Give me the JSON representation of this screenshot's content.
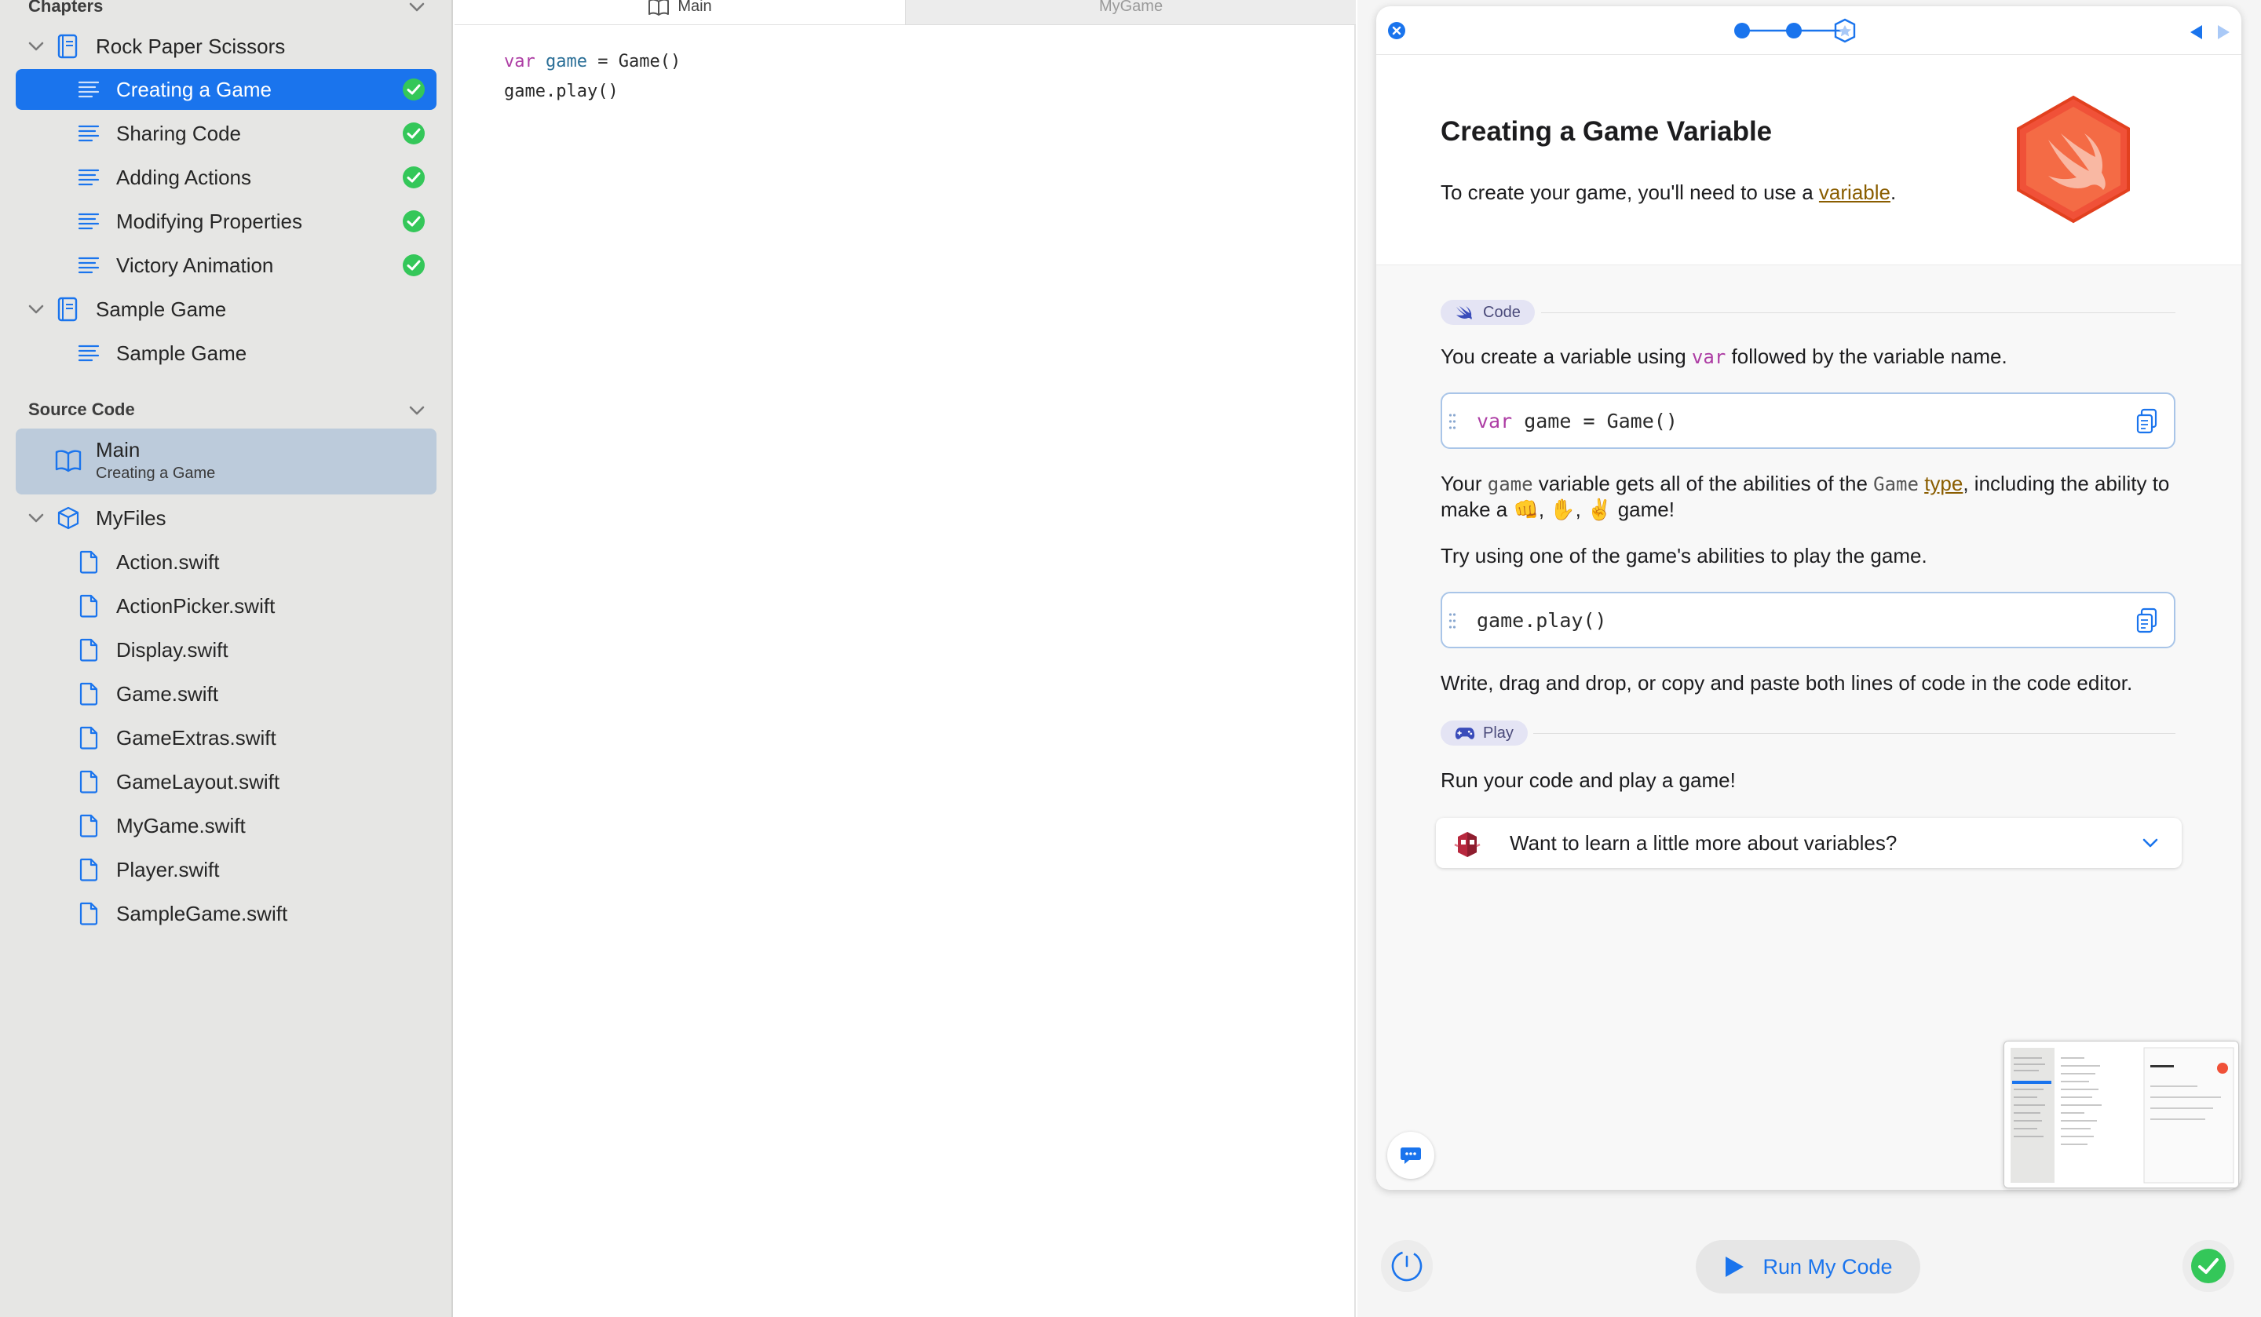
{
  "sidebar": {
    "chapters_heading": "Chapters",
    "rps": {
      "title": "Rock Paper Scissors",
      "items": [
        {
          "label": "Creating a Game"
        },
        {
          "label": "Sharing Code"
        },
        {
          "label": "Adding Actions"
        },
        {
          "label": "Modifying Properties"
        },
        {
          "label": "Victory Animation"
        }
      ]
    },
    "sample_game": {
      "title": "Sample Game",
      "items": [
        {
          "label": "Sample Game"
        }
      ]
    },
    "source_code_heading": "Source Code",
    "main": {
      "title": "Main",
      "subtitle": "Creating a Game"
    },
    "myfiles": {
      "title": "MyFiles",
      "files": [
        "Action.swift",
        "ActionPicker.swift",
        "Display.swift",
        "Game.swift",
        "GameExtras.swift",
        "GameLayout.swift",
        "MyGame.swift",
        "Player.swift",
        "SampleGame.swift"
      ]
    }
  },
  "editor": {
    "tabs": [
      "Main",
      "MyGame"
    ],
    "code": {
      "line1": {
        "kw": "var",
        "name": "game",
        "rest": " = Game()"
      },
      "line2": "game.play()"
    }
  },
  "guide": {
    "title": "Creating a Game Variable",
    "subtitle_pre": "To create your game, you'll need to use a ",
    "subtitle_link": "variable",
    "subtitle_post": ".",
    "code_section_label": "Code",
    "p1_pre": "You create a variable using ",
    "p1_code": "var",
    "p1_post": " followed by the variable name.",
    "code1": {
      "kw": "var",
      "rest": " game = Game()"
    },
    "p2_a": "Your ",
    "p2_code1": "game",
    "p2_b": " variable gets all of the abilities of the ",
    "p2_code2": "Game",
    "p2_link": "type",
    "p2_c": ", including the ability to make a 👊, ✋, ✌️ game!",
    "p3": "Try using one of the game's abilities to play the game.",
    "code2": "game.play()",
    "p4": "Write, drag and drop, or copy and paste both lines of code in the code editor.",
    "play_section_label": "Play",
    "p5": "Run your code and play a game!",
    "disclosure": "Want to learn a little more about variables?"
  },
  "bottom_bar": {
    "run_label": "Run My Code"
  },
  "colors": {
    "accent": "#1a74ed",
    "success": "#34c759",
    "swift_orange": "#f05138"
  }
}
